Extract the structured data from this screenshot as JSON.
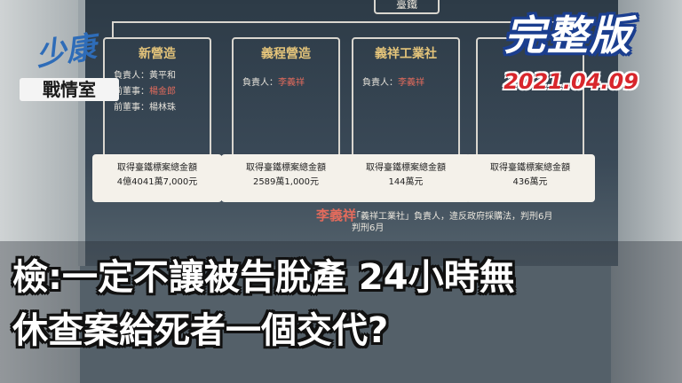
{
  "board": {
    "top_label": "臺鐵",
    "cards": [
      {
        "title": "新營造",
        "lines": [
          {
            "label": "負責人：",
            "name": "黃平和",
            "highlight": false
          },
          {
            "label": "前董事：",
            "name": "楊金郎",
            "highlight": true
          },
          {
            "label": "前董事：",
            "name": "楊林珠",
            "highlight": false
          }
        ],
        "stat_label": "取得臺鐵標案總金額",
        "stat_value": "4億4041萬7,000元"
      },
      {
        "title": "義程營造",
        "lines": [
          {
            "label": "負責人：",
            "name": "李義祥",
            "highlight": true
          }
        ],
        "stat_label": "取得臺鐵標案總金額",
        "stat_value": "2589萬1,000元"
      },
      {
        "title": "義祥工業社",
        "lines": [
          {
            "label": "負責人：",
            "name": "李義祥",
            "highlight": true
          }
        ],
        "stat_label": "取得臺鐵標案總金額",
        "stat_value": "144萬元"
      },
      {
        "title": "",
        "lines": [],
        "stat_label": "取得臺鐵標案總金額",
        "stat_value": "436萬元"
      }
    ],
    "under_name": "李義祥",
    "under_lines": [
      "「義祥工業社」負責人，違反政府採購法，判刑6月",
      "判刑6月"
    ]
  },
  "logo": {
    "mark": "少康",
    "subtitle": "戰情室"
  },
  "badge": {
    "title": "完整版",
    "date": "2021.04.09"
  },
  "caption": {
    "line1": "檢:一定不讓被告脫產 24小時無",
    "line2": "休查案給死者一個交代?"
  }
}
